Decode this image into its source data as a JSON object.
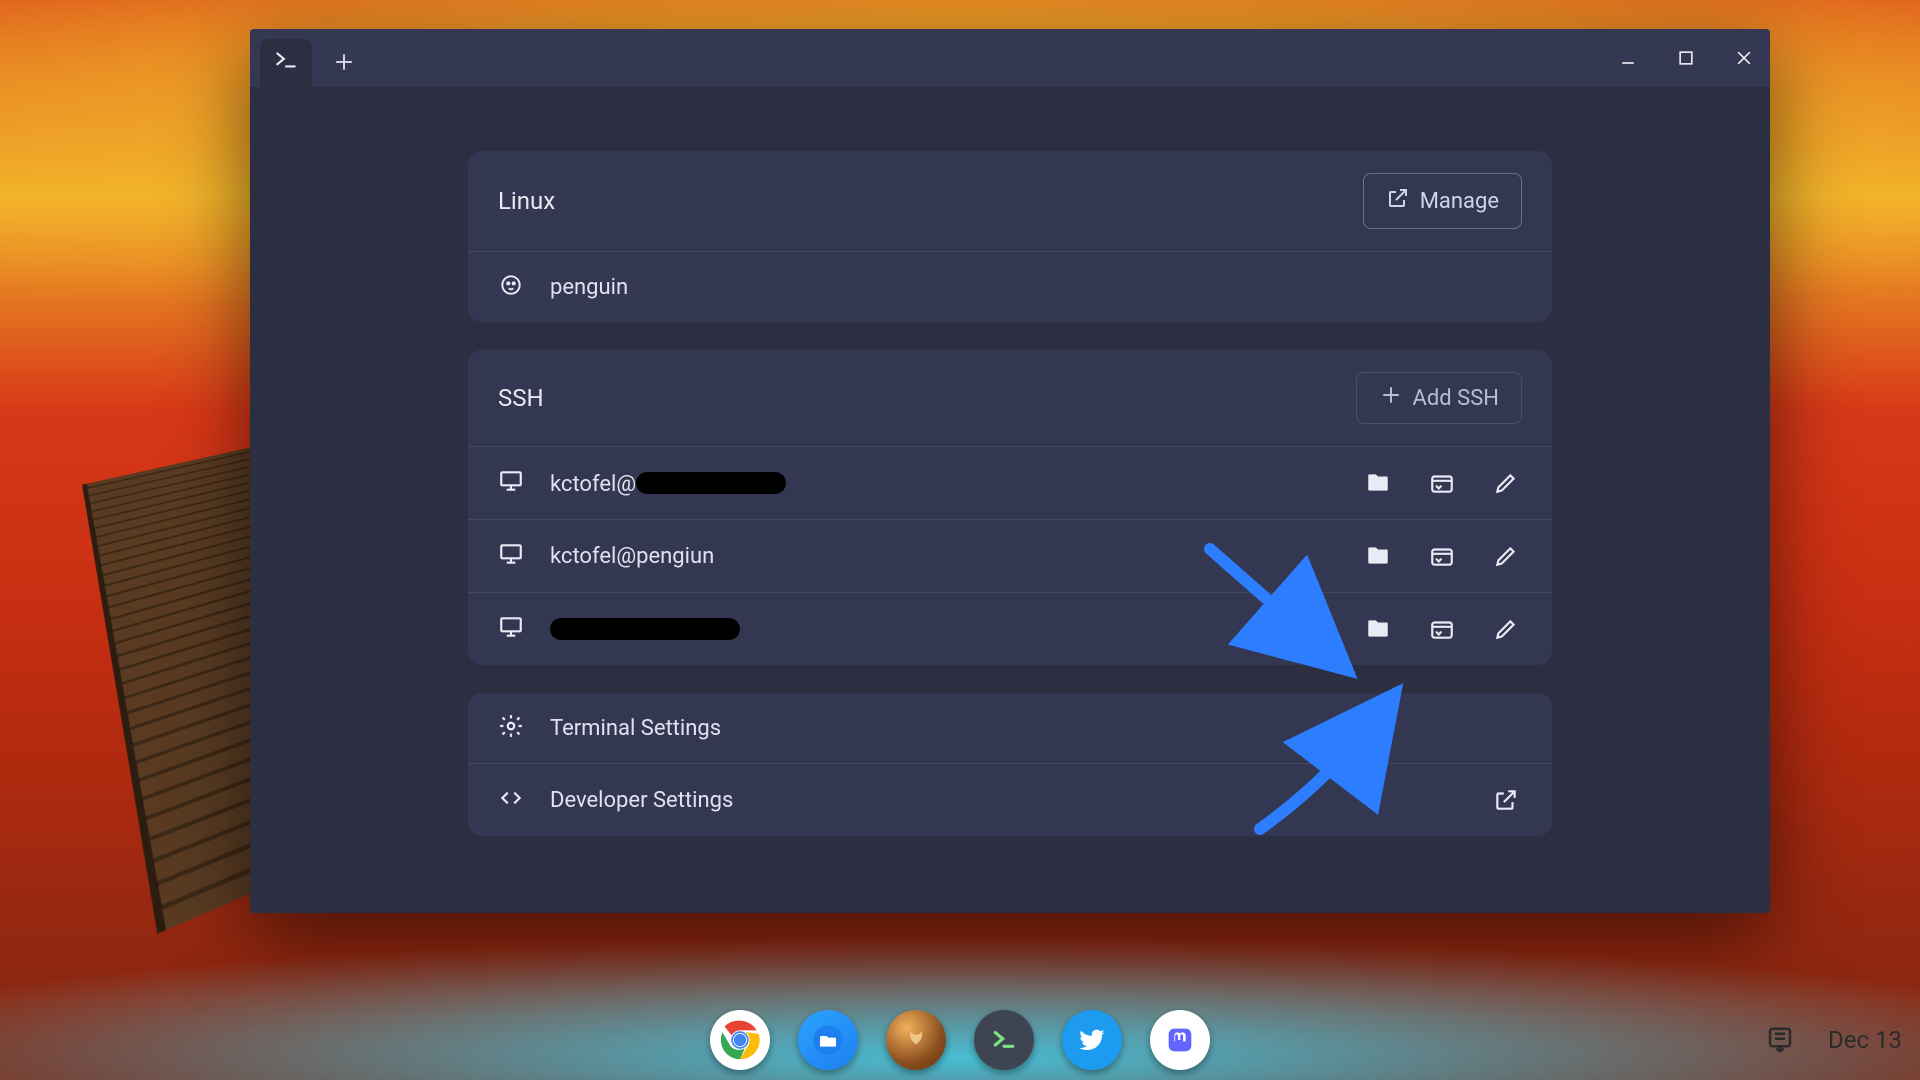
{
  "sections": {
    "linux": {
      "title": "Linux",
      "manage_label": "Manage",
      "items": [
        {
          "label": "penguin"
        }
      ]
    },
    "ssh": {
      "title": "SSH",
      "add_label": "Add SSH",
      "items": [
        {
          "label_prefix": "kctofel@",
          "redacted": true,
          "label_full": ""
        },
        {
          "label_prefix": "",
          "redacted": false,
          "label_full": "kctofel@pengiun"
        },
        {
          "label_prefix": "",
          "redacted": true,
          "label_full": ""
        }
      ]
    },
    "settings": {
      "terminal_label": "Terminal Settings",
      "developer_label": "Developer Settings"
    }
  },
  "shelf": {
    "clock": "Dec 13",
    "icons": [
      "chrome",
      "files",
      "custom",
      "terminal",
      "twitter",
      "mastodon"
    ]
  }
}
